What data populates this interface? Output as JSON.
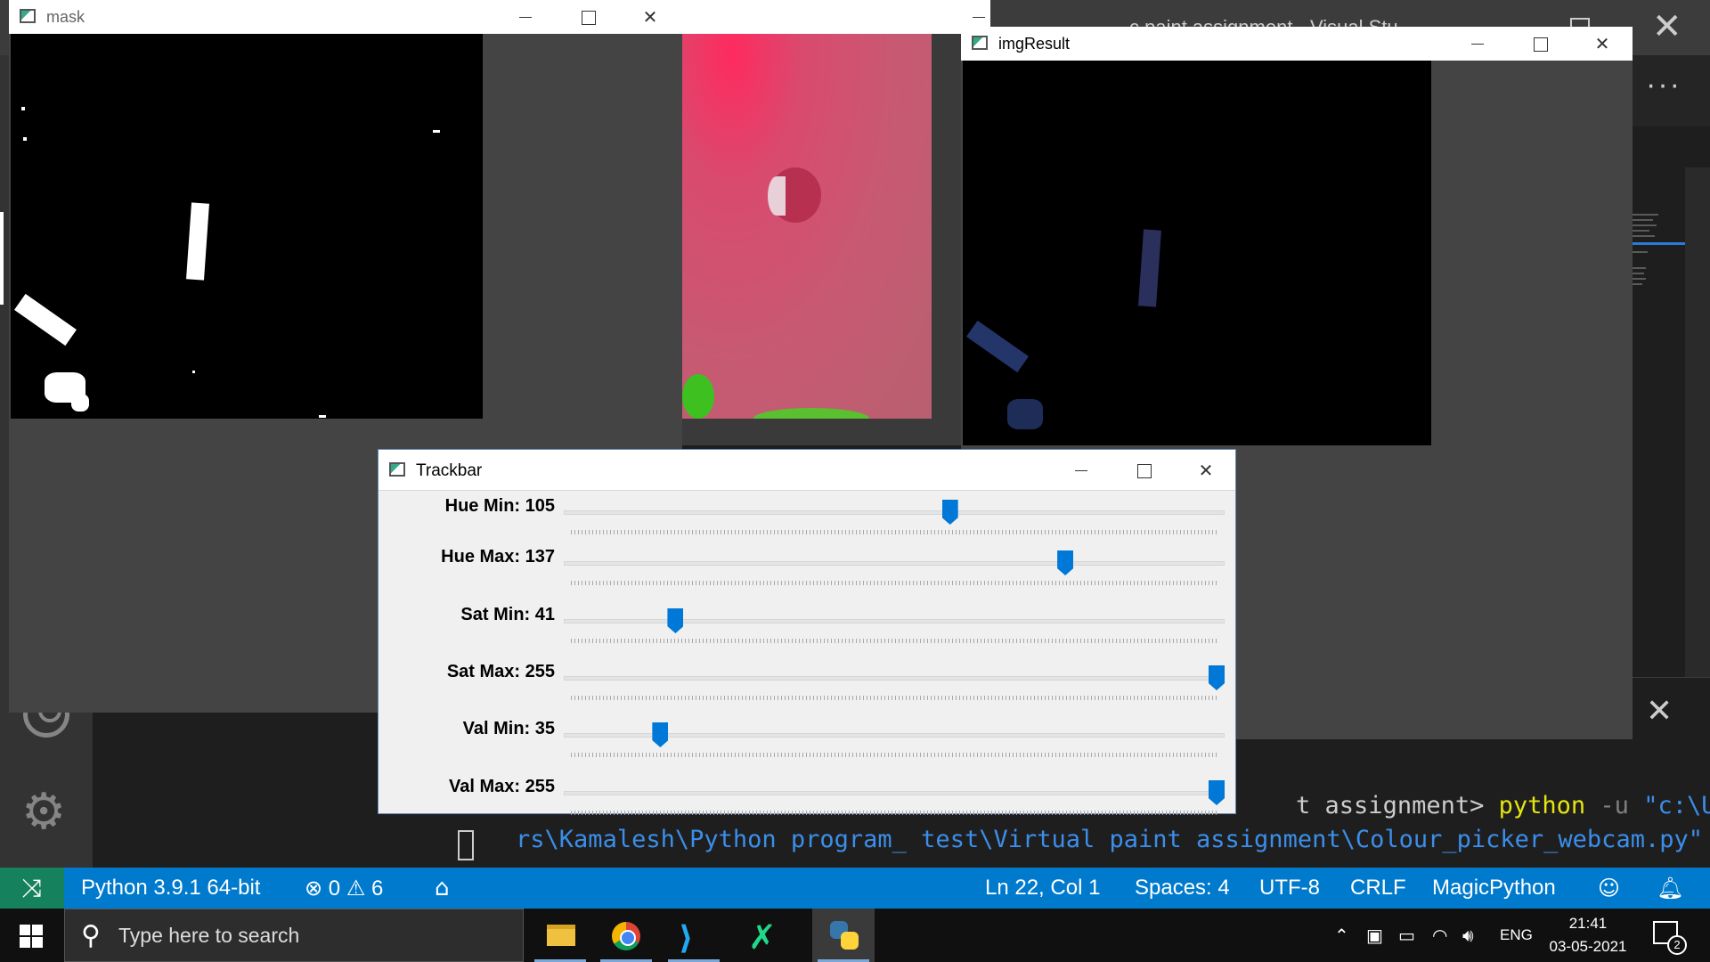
{
  "vscode": {
    "title_fragment": "c paint assignment - Visual Stu",
    "more_label": "···",
    "panel_close_label": "✕",
    "terminal": {
      "line1_prompt": "t assignment> ",
      "line1_cmd": "python",
      "line1_flag": " -u ",
      "line1_str": "\"c:\\Use",
      "line2_str": "rs\\Kamalesh\\Python program_ test\\Virtual paint assignment\\Colour_picker_webcam.py\""
    },
    "statusbar": {
      "python": "Python 3.9.1 64-bit",
      "errors": "0",
      "warnings": "6",
      "position": "Ln 22, Col 1",
      "spaces": "Spaces: 4",
      "encoding": "UTF-8",
      "eol": "CRLF",
      "language": "MagicPython"
    }
  },
  "windows": {
    "mask": {
      "title": "mask"
    },
    "camera": {
      "title": ""
    },
    "result": {
      "title": "imgResult"
    },
    "trackbar": {
      "title": "Trackbar"
    }
  },
  "trackbars": [
    {
      "label": "Hue Min: 105",
      "value": 105,
      "max": 179
    },
    {
      "label": "Hue Max: 137",
      "value": 137,
      "max": 179
    },
    {
      "label": "Sat Min: 41",
      "value": 41,
      "max": 255
    },
    {
      "label": "Sat Max: 255",
      "value": 255,
      "max": 255
    },
    {
      "label": "Val Min: 35",
      "value": 35,
      "max": 255
    },
    {
      "label": "Val Max: 255",
      "value": 255,
      "max": 255
    }
  ],
  "taskbar": {
    "search_placeholder": "Type here to search",
    "language": "ENG",
    "time": "21:41",
    "date": "03-05-2021",
    "notification_count": "2"
  },
  "icons": {
    "remote": "remote-icon",
    "error": "error-icon",
    "warning": "warning-icon",
    "home": "home-icon",
    "feedback": "feedback-icon",
    "bell": "bell-icon",
    "account": "account-icon",
    "settings": "gear-icon"
  },
  "colors": {
    "statusbar": "#007acc",
    "remote": "#16825d",
    "thumb": "#0078d7"
  }
}
